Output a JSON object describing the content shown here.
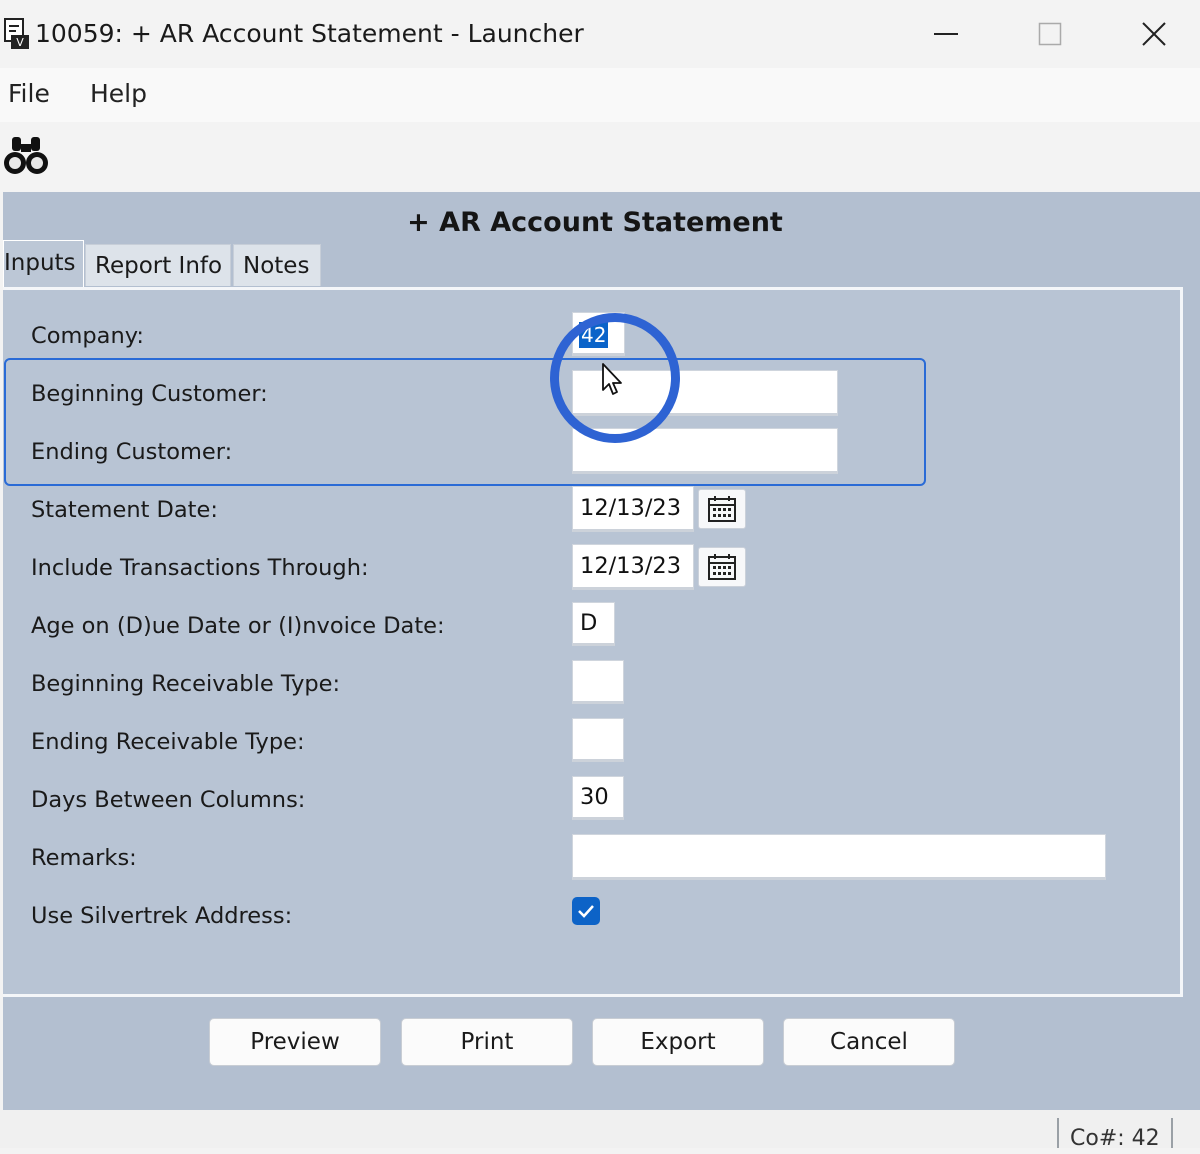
{
  "window": {
    "title": "10059: + AR Account Statement - Launcher",
    "app_icon": "report-launcher-icon",
    "controls": {
      "minimize": "minimize-icon",
      "maximize": "maximize-icon",
      "close": "close-icon"
    }
  },
  "menu": {
    "file": "File",
    "help": "Help"
  },
  "toolbar": {
    "find_icon": "binoculars-icon"
  },
  "form": {
    "title": "+ AR Account Statement"
  },
  "tabs": [
    {
      "label": "Inputs",
      "active": true
    },
    {
      "label": "Report Info",
      "active": false
    },
    {
      "label": "Notes",
      "active": false
    }
  ],
  "fields": {
    "company": {
      "label": "Company:",
      "value": "42"
    },
    "beginning_customer": {
      "label": "Beginning Customer:",
      "value": ""
    },
    "ending_customer": {
      "label": "Ending Customer:",
      "value": ""
    },
    "statement_date": {
      "label": "Statement Date:",
      "value": "12/13/23"
    },
    "include_through": {
      "label": "Include Transactions Through:",
      "value": "12/13/23"
    },
    "age_on": {
      "label": "Age on (D)ue Date or (I)nvoice Date:",
      "value": "D"
    },
    "begin_recv_type": {
      "label": "Beginning Receivable Type:",
      "value": ""
    },
    "end_recv_type": {
      "label": "Ending Receivable Type:",
      "value": ""
    },
    "days_between": {
      "label": "Days Between Columns:",
      "value": "30"
    },
    "remarks": {
      "label": "Remarks:",
      "value": ""
    },
    "use_silvertrek": {
      "label": "Use Silvertrek Address:",
      "checked": true
    }
  },
  "buttons": {
    "preview": "Preview",
    "print": "Print",
    "export": "Export",
    "cancel": "Cancel"
  },
  "status": {
    "company": "Co#: 42"
  },
  "colors": {
    "accent": "#2a6bd6",
    "panel": "#b8c4d4",
    "checkbox": "#0d63c7"
  }
}
